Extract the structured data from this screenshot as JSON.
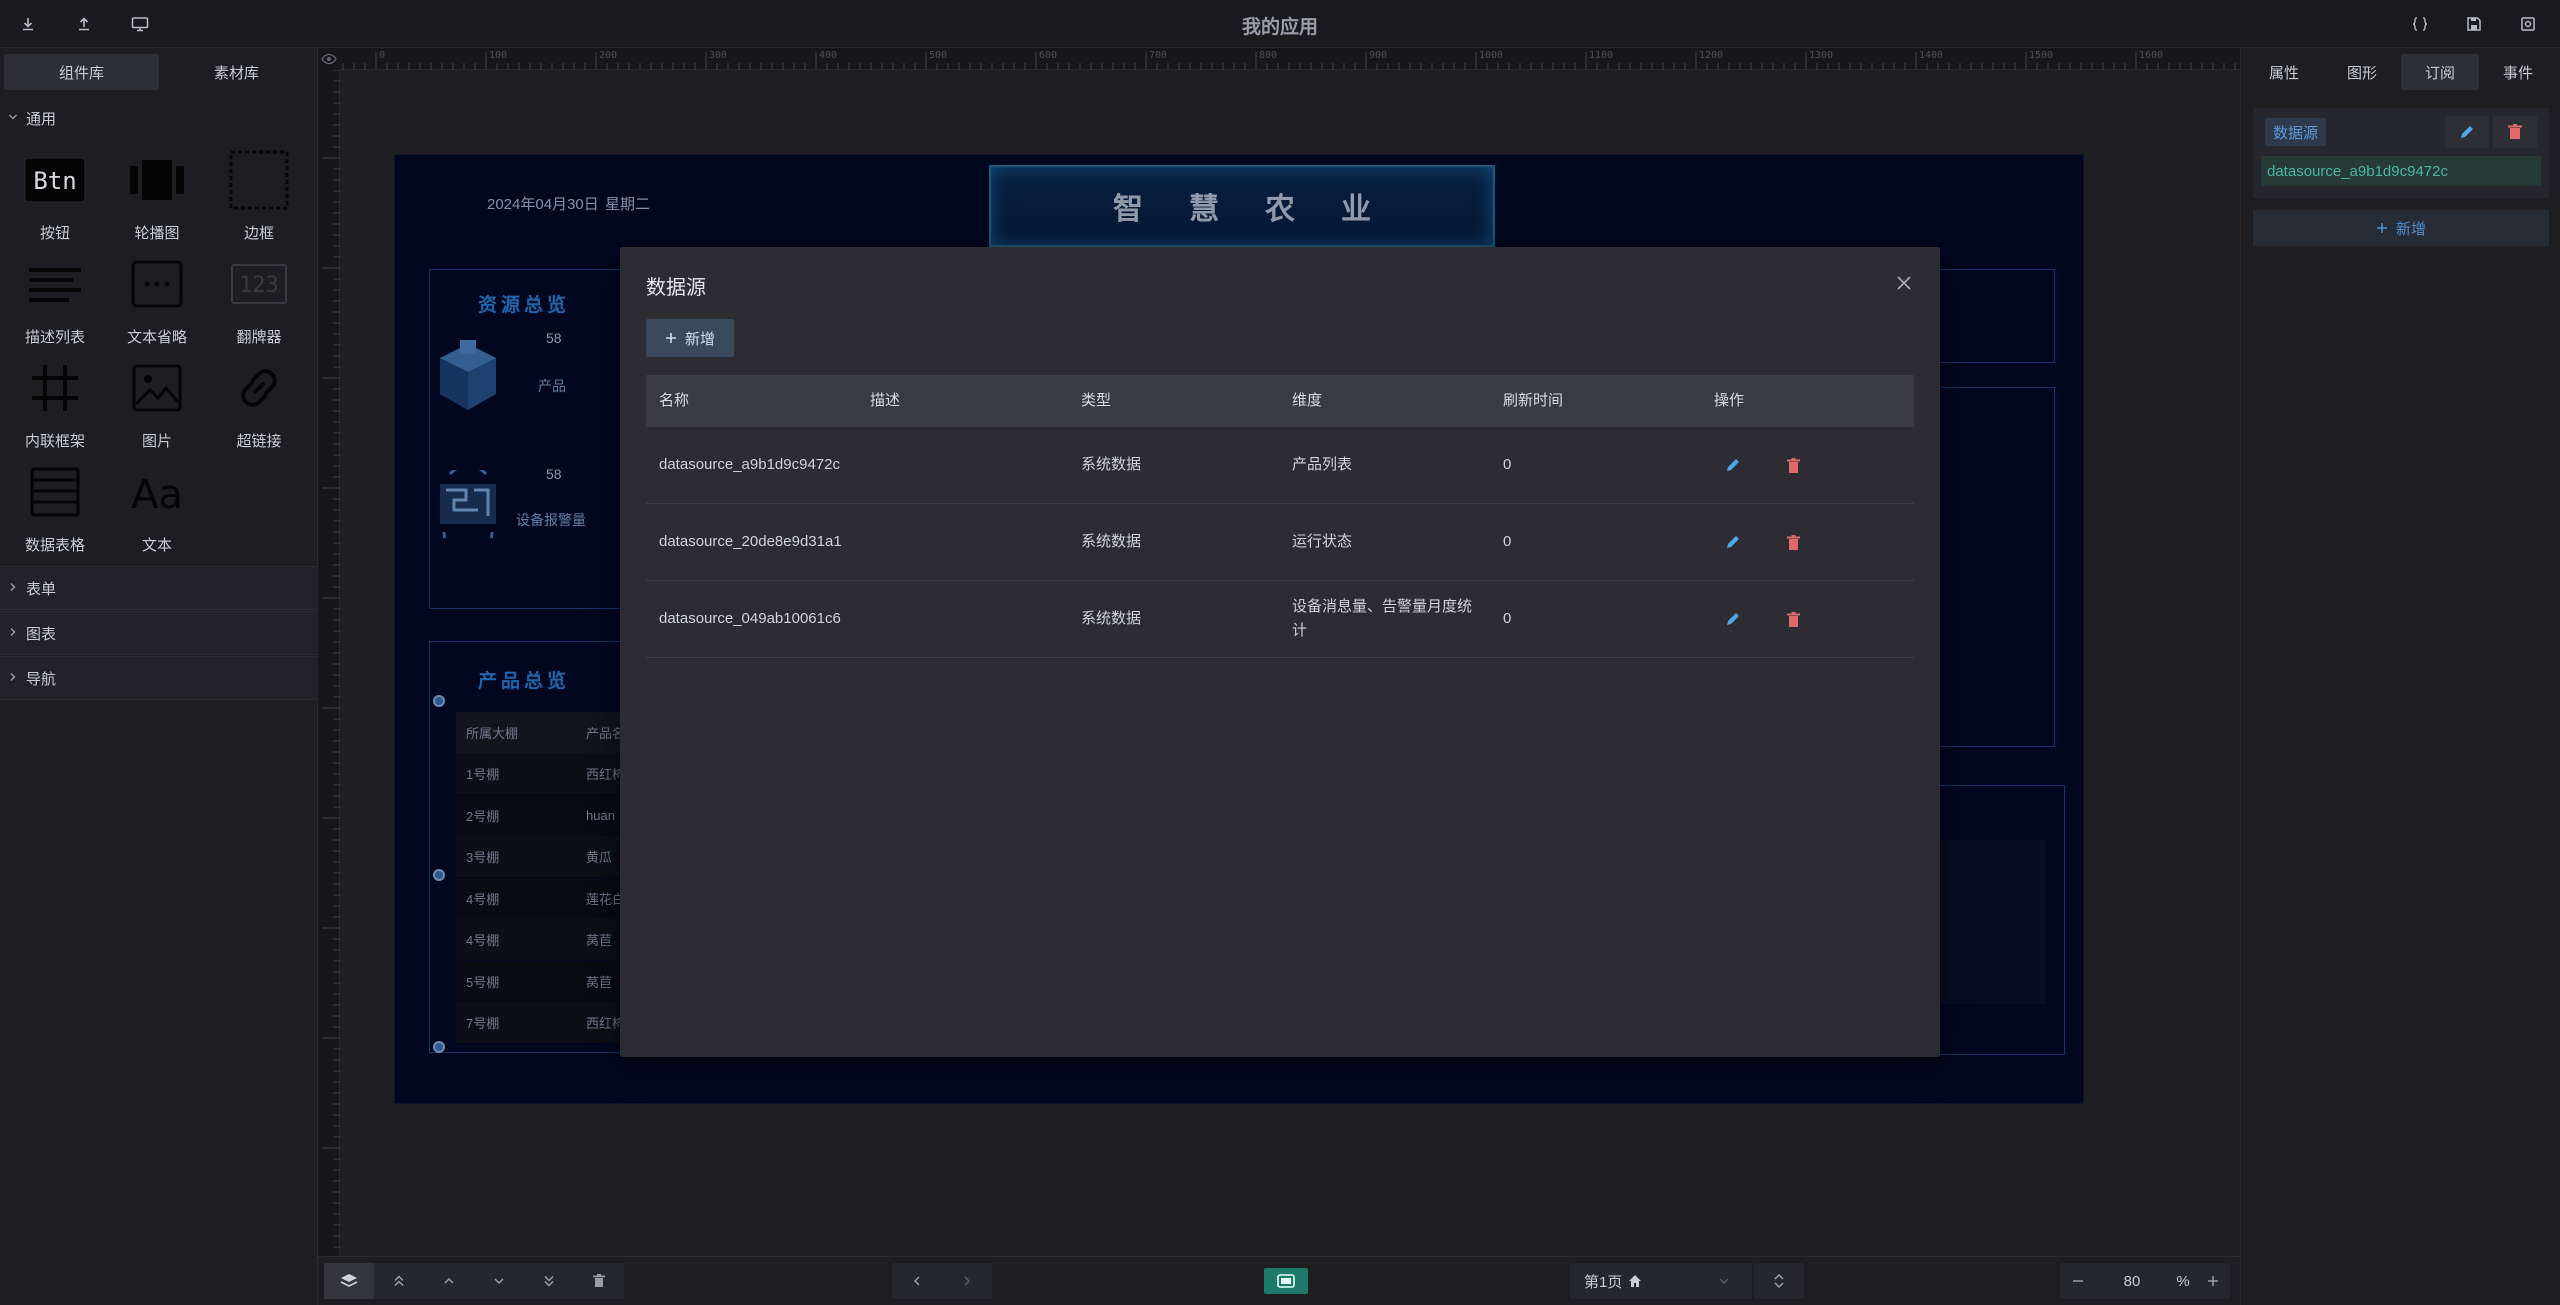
{
  "app": {
    "title": "我的应用"
  },
  "left_panel": {
    "tabs": [
      "组件库",
      "素材库"
    ],
    "section_general": "通用",
    "components": [
      {
        "label": "按钮",
        "icon": "btn-icon"
      },
      {
        "label": "轮播图",
        "icon": "carousel-icon"
      },
      {
        "label": "边框",
        "icon": "border-icon"
      },
      {
        "label": "描述列表",
        "icon": "description-list-icon"
      },
      {
        "label": "文本省略",
        "icon": "text-ellipsis-icon"
      },
      {
        "label": "翻牌器",
        "icon": "flip-counter-icon"
      },
      {
        "label": "内联框架",
        "icon": "iframe-icon"
      },
      {
        "label": "图片",
        "icon": "image-icon"
      },
      {
        "label": "超链接",
        "icon": "link-icon"
      },
      {
        "label": "数据表格",
        "icon": "data-table-icon"
      },
      {
        "label": "文本",
        "icon": "text-icon"
      }
    ],
    "btn_glyph": "Btn",
    "flip_glyph": "123",
    "text_glyph": "Aa",
    "collapsed_sections": [
      "表单",
      "图表",
      "导航"
    ]
  },
  "canvas": {
    "ruler_ticks": [
      "0",
      "100",
      "200",
      "300",
      "400",
      "500",
      "600",
      "700",
      "800",
      "900",
      "1000",
      "1100",
      "1200",
      "1300",
      "1400",
      "1500",
      "1600"
    ],
    "date": "2024年04月30日",
    "weekday": "星期二",
    "main_title": "智慧农业",
    "resource_panel": {
      "title": "资源总览",
      "products_num": "58",
      "products_label": "产品",
      "devices_num": "58",
      "devices_label": "设备报警量"
    },
    "product_panel": {
      "title": "产品总览",
      "headers": [
        "所属大棚",
        "产品名"
      ],
      "rows": [
        [
          "1号棚",
          "西红柿"
        ],
        [
          "2号棚",
          "huan"
        ],
        [
          "3号棚",
          "黄瓜"
        ],
        [
          "4号棚",
          "莲花白"
        ],
        [
          "4号棚",
          "莴苣"
        ],
        [
          "5号棚",
          "莴苣"
        ],
        [
          "7号棚",
          "西红柿"
        ]
      ]
    }
  },
  "dialog": {
    "title": "数据源",
    "add_label": "新增",
    "headers": [
      "名称",
      "描述",
      "类型",
      "维度",
      "刷新时间",
      "操作"
    ],
    "rows": [
      {
        "name": "datasource_a9b1d9c9472c",
        "desc": "",
        "type": "系统数据",
        "dimension": "产品列表",
        "refresh": "0"
      },
      {
        "name": "datasource_20de8e9d31a1",
        "desc": "",
        "type": "系统数据",
        "dimension": "运行状态",
        "refresh": "0"
      },
      {
        "name": "datasource_049ab10061c6",
        "desc": "",
        "type": "系统数据",
        "dimension": "设备消息量、告警量月度统计",
        "refresh": "0"
      }
    ]
  },
  "right_panel": {
    "tabs": [
      "属性",
      "图形",
      "订阅",
      "事件"
    ],
    "active_tab": "订阅",
    "badge": "数据源",
    "selected_value": "datasource_a9b1d9c9472c",
    "add_label": "新增"
  },
  "bottom_bar": {
    "page_label": "第1页",
    "zoom_value": "80",
    "zoom_unit": "%"
  },
  "colors": {
    "accent": "#2f8ef0",
    "teal": "#1e7a6a",
    "danger": "#e06a6a",
    "edit": "#4fa8e6"
  }
}
